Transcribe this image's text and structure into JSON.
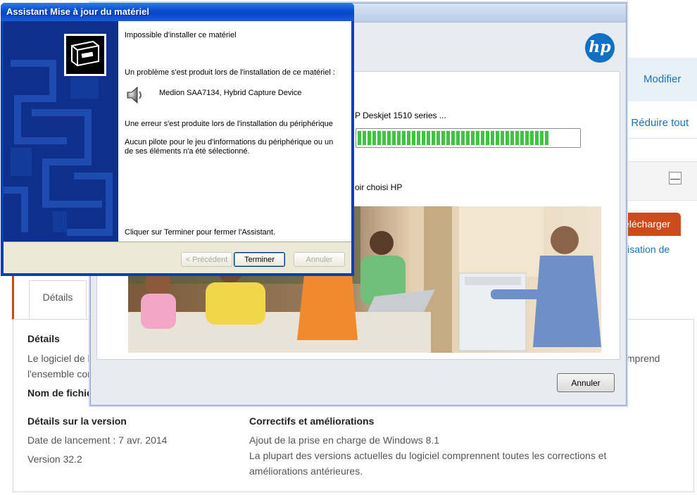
{
  "web": {
    "modify_link": "Modifier",
    "expand_partial": "t",
    "expand_separator": "|",
    "collapse_all": "Réduire tout",
    "collapse_symbol": "—",
    "download_button": "élécharger",
    "usage_link": "ilisation de",
    "details_tab": "Détails",
    "panel": {
      "details_heading": "Détails",
      "desc_line1": "Le logiciel de la",
      "desc_line1_end": "mprend",
      "desc_line2": "l'ensemble com",
      "filename_label": "Nom de fichie",
      "version_details_heading": "Détails sur la version",
      "release_date": "Date de lancement : 7 avr. 2014",
      "version": "Version 32.2",
      "fixes_heading": "Correctifs et améliorations",
      "fix_line1": "Ajout de la prise en charge de Windows 8.1",
      "fix_line2": "La plupart des versions actuelles du logiciel comprennent toutes les corrections et",
      "fix_line3": "améliorations antérieures."
    }
  },
  "hp_installer": {
    "logo_text": "hp",
    "status_text": "P Deskjet 1510 series ...",
    "progress_percent": 87,
    "thanks_text": "oir choisi HP",
    "cancel_button": "Annuler",
    "colors": {
      "brand_blue": "#1071c4",
      "progress_green": "#3fc43f"
    }
  },
  "wizard": {
    "title": "Assistant Mise à jour du matériel",
    "heading": "Impossible d'installer ce matériel",
    "problem_text": "Un problème s'est produit lors de l'installation de ce matériel :",
    "device_name": "Medion SAA7134, Hybrid Capture Device",
    "error_text": "Une erreur s'est produite lors de l'installation du périphérique",
    "driver_line1": "Aucun pilote pour le jeu d'informations du périphérique ou un",
    "driver_line2": "de ses éléments n'a été sélectionné.",
    "finish_hint": "Cliquer sur Terminer pour fermer l'Assistant.",
    "back_button": "< Précédent",
    "finish_button": "Terminer",
    "cancel_button": "Annuler",
    "colors": {
      "titlebar": "#0a4fd4",
      "sidebar": "#0f2f8c",
      "face": "#ece9d8"
    }
  }
}
